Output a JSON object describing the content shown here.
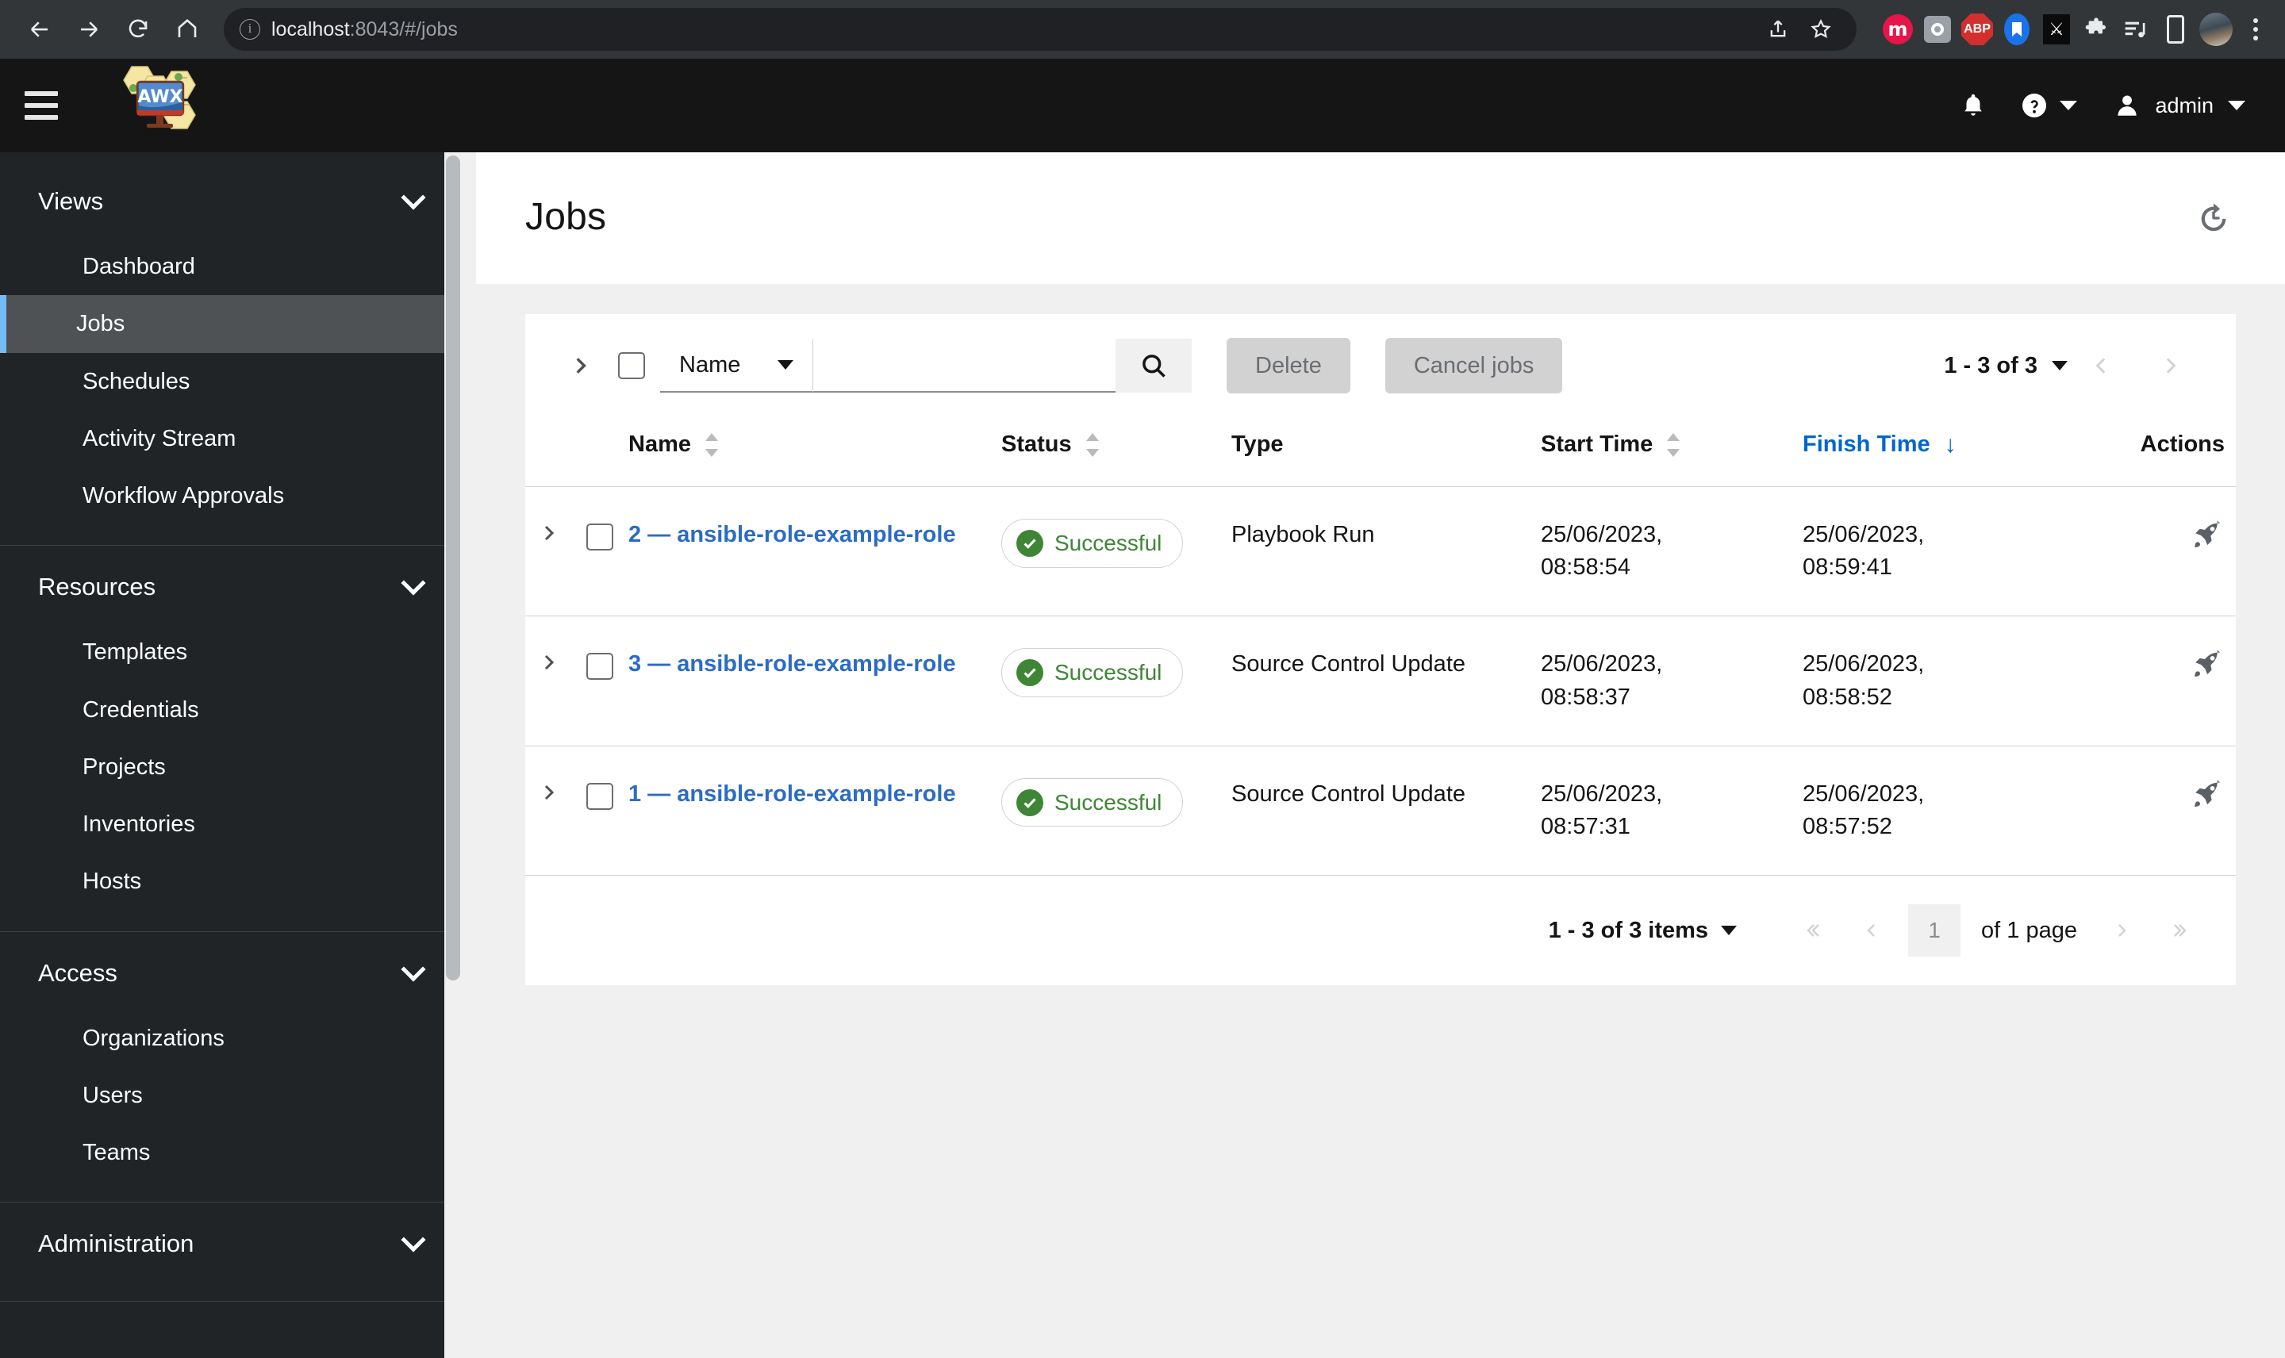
{
  "browser": {
    "back_icon": "back-arrow-icon",
    "forward_icon": "forward-arrow-icon",
    "reload_icon": "reload-icon",
    "home_icon": "home-icon",
    "site_info_icon": "site-info-icon",
    "url_host": "localhost",
    "url_path": ":8043/#/jobs",
    "share_icon": "share-icon",
    "bookmark_icon": "star-icon",
    "extensions": [
      "mint-extension-icon",
      "camera-extension-icon",
      "adblock-plus-icon",
      "bookmark-manager-icon",
      "dark-reader-icon",
      "puzzle-extensions-icon",
      "reading-list-icon",
      "device-toolbar-icon"
    ],
    "profile_icon": "profile-avatar",
    "menu_icon": "kebab-menu-icon"
  },
  "masthead": {
    "menu_toggle_icon": "hamburger-menu-icon",
    "logo_text": "AWX",
    "notifications_icon": "bell-icon",
    "help_icon": "question-circle-icon",
    "user_icon": "user-icon",
    "username": "admin"
  },
  "sidebar": {
    "groups": [
      {
        "label": "Views",
        "items": [
          {
            "label": "Dashboard",
            "active": false
          },
          {
            "label": "Jobs",
            "active": true
          },
          {
            "label": "Schedules",
            "active": false
          },
          {
            "label": "Activity Stream",
            "active": false
          },
          {
            "label": "Workflow Approvals",
            "active": false
          }
        ]
      },
      {
        "label": "Resources",
        "items": [
          {
            "label": "Templates",
            "active": false
          },
          {
            "label": "Credentials",
            "active": false
          },
          {
            "label": "Projects",
            "active": false
          },
          {
            "label": "Inventories",
            "active": false
          },
          {
            "label": "Hosts",
            "active": false
          }
        ]
      },
      {
        "label": "Access",
        "items": [
          {
            "label": "Organizations",
            "active": false
          },
          {
            "label": "Users",
            "active": false
          },
          {
            "label": "Teams",
            "active": false
          }
        ]
      },
      {
        "label": "Administration",
        "items": []
      }
    ]
  },
  "page": {
    "title": "Jobs",
    "history_icon": "history-icon"
  },
  "toolbar": {
    "expand_icon": "chevron-right-icon",
    "select_all_checkbox": "select-all-checkbox",
    "filter_field": "Name",
    "search_value": "",
    "search_placeholder": "",
    "search_icon": "search-icon",
    "delete_label": "Delete",
    "cancel_jobs_label": "Cancel jobs",
    "pager_range": "1 - 3 of 3",
    "prev_icon": "chevron-left-icon",
    "next_icon": "chevron-right-icon"
  },
  "table": {
    "columns": [
      {
        "label": "Name",
        "sortable": true,
        "active": false
      },
      {
        "label": "Status",
        "sortable": true,
        "active": false
      },
      {
        "label": "Type",
        "sortable": false,
        "active": false
      },
      {
        "label": "Start Time",
        "sortable": true,
        "active": false
      },
      {
        "label": "Finish Time",
        "sortable": true,
        "active": true,
        "direction": "desc"
      },
      {
        "label": "Actions",
        "sortable": false,
        "active": false
      }
    ],
    "rows": [
      {
        "expand_icon": "chevron-right-icon",
        "name": "2 — ansible-role-example-role",
        "status": "Successful",
        "status_color": "#3e8635",
        "type": "Playbook Run",
        "start_time": "25/06/2023,\n08:58:54",
        "finish_time": "25/06/2023,\n08:59:41",
        "action_icon": "rocket-relaunch-icon"
      },
      {
        "expand_icon": "chevron-right-icon",
        "name": "3 — ansible-role-example-role",
        "status": "Successful",
        "status_color": "#3e8635",
        "type": "Source Control Update",
        "start_time": "25/06/2023,\n08:58:37",
        "finish_time": "25/06/2023,\n08:58:52",
        "action_icon": "rocket-relaunch-icon"
      },
      {
        "expand_icon": "chevron-right-icon",
        "name": "1 — ansible-role-example-role",
        "status": "Successful",
        "status_color": "#3e8635",
        "type": "Source Control Update",
        "start_time": "25/06/2023,\n08:57:31",
        "finish_time": "25/06/2023,\n08:57:52",
        "action_icon": "rocket-relaunch-icon"
      }
    ]
  },
  "bottom_pagination": {
    "items_range": "1 - 3 of 3 items",
    "first_icon": "double-chevron-left-icon",
    "prev_icon": "chevron-left-icon",
    "page_value": "1",
    "of_pages": "of 1 page",
    "next_icon": "chevron-right-icon",
    "last_icon": "double-chevron-right-icon"
  },
  "colors": {
    "accent_link": "#2b6cc4",
    "sort_active": "#0066cc",
    "success": "#3e8635",
    "sidebar_bg": "#212427",
    "masthead_bg": "#151515",
    "active_nav_border": "#73bcf7"
  }
}
